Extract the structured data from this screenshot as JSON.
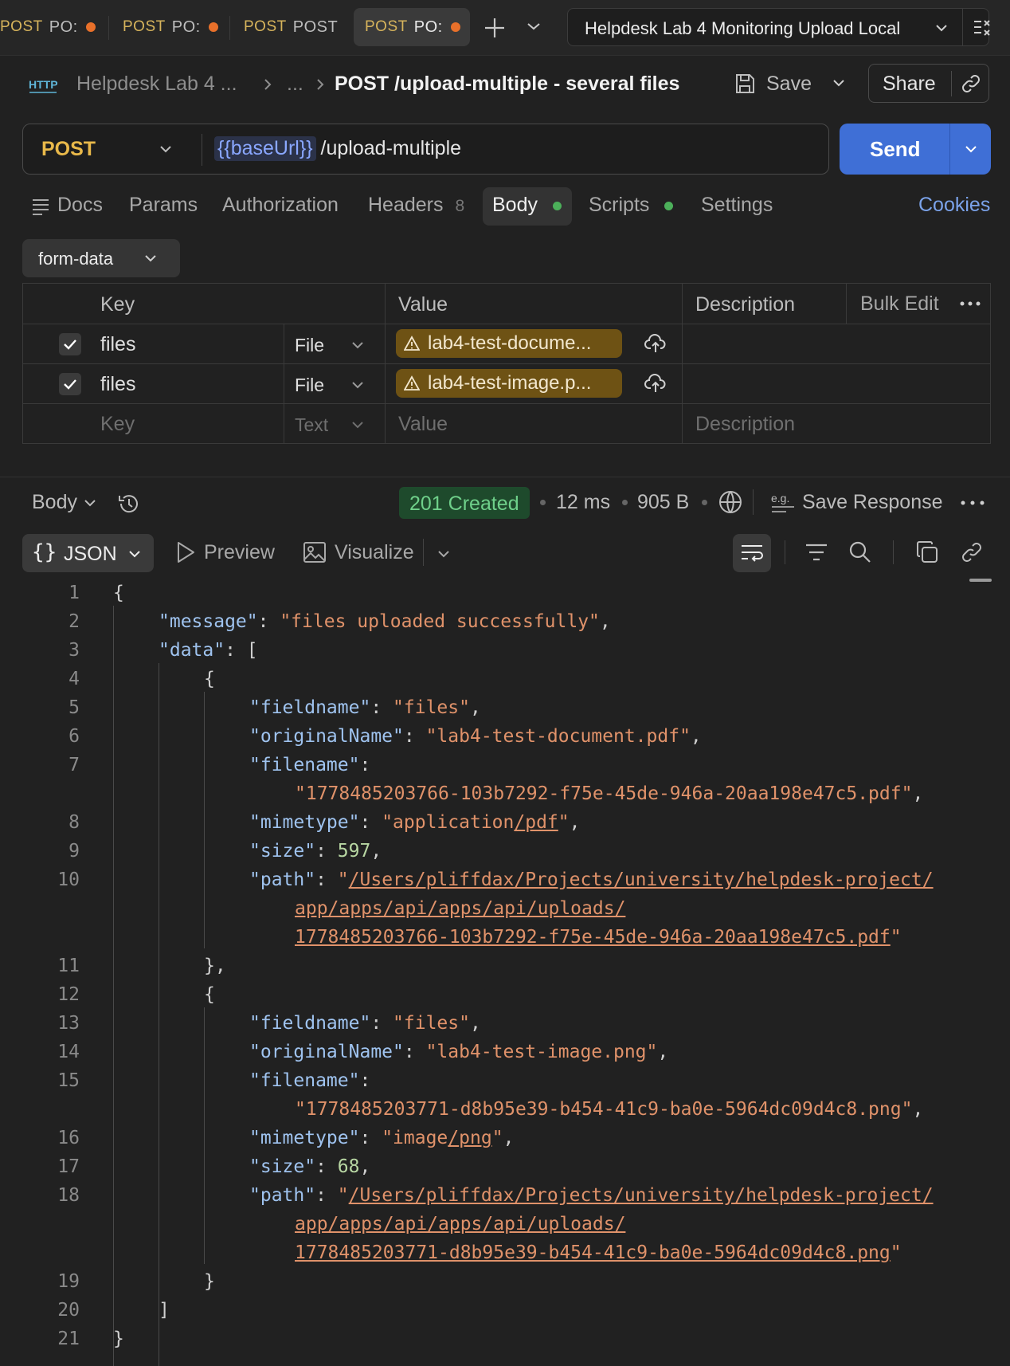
{
  "tabs": [
    {
      "method": "POST",
      "title": "PO:",
      "unsaved": true
    },
    {
      "method": "POST",
      "title": "PO:",
      "unsaved": true
    },
    {
      "method": "POST",
      "title": "POST",
      "unsaved": false
    },
    {
      "method": "POST",
      "title": "PO:",
      "unsaved": true,
      "active": true
    }
  ],
  "environment": "Helpdesk Lab 4 Monitoring Upload Local",
  "header": {
    "protocol_icon": "http-icon",
    "collection_crumb": "Helpdesk Lab 4 ...",
    "ellipsis_crumb": "...",
    "title": "POST /upload-multiple - several files",
    "save_label": "Save",
    "share_label": "Share"
  },
  "request": {
    "method": "POST",
    "url_variable": "{{baseUrl}}",
    "url_path": "/upload-multiple",
    "send_label": "Send"
  },
  "request_tabs": {
    "docs": "Docs",
    "params": "Params",
    "authorization": "Authorization",
    "headers": "Headers",
    "headers_count": "8",
    "body": "Body",
    "scripts": "Scripts",
    "settings": "Settings",
    "cookies": "Cookies"
  },
  "body_mode": "form-data",
  "form_table": {
    "headers": {
      "key": "Key",
      "value": "Value",
      "description": "Description",
      "bulk_edit": "Bulk Edit"
    },
    "rows": [
      {
        "checked": true,
        "key": "files",
        "type": "File",
        "value": "lab4-test-docume..."
      },
      {
        "checked": true,
        "key": "files",
        "type": "File",
        "value": "lab4-test-image.p..."
      }
    ],
    "placeholder": {
      "key": "Key",
      "type": "Text",
      "value": "Value",
      "description": "Description"
    }
  },
  "response": {
    "view_label": "Body",
    "status": "201 Created",
    "time": "12 ms",
    "size": "905 B",
    "save_response": "Save Response",
    "format": "JSON",
    "preview": "Preview",
    "visualize": "Visualize"
  },
  "code": {
    "line_numbers": [
      "1",
      "2",
      "3",
      "4",
      "5",
      "6",
      "7",
      "8",
      "9",
      "10",
      "11",
      "12",
      "13",
      "14",
      "15",
      "16",
      "17",
      "18",
      "19",
      "20",
      "21"
    ],
    "message_key": "\"message\"",
    "message_val": "\"files uploaded successfully\"",
    "data_key": "\"data\"",
    "files": [
      {
        "fieldname_key": "\"fieldname\"",
        "fieldname_val": "\"files\"",
        "original_key": "\"originalName\"",
        "original_val": "\"lab4-test-document.pdf\"",
        "filename_key": "\"filename\"",
        "filename_val": "\"1778485203766-103b7292-f75e-45de-946a-20aa198e47c5.pdf\"",
        "mimetype_key": "\"mimetype\"",
        "mimetype_a": "application",
        "mimetype_b": "pdf",
        "size_key": "\"size\"",
        "size_val": "597",
        "path_key": "\"path\"",
        "path_1": "/Users/pliffdax/Projects/university/helpdesk-project/",
        "path_2": "app/apps/api/apps/api/uploads/",
        "path_3": "1778485203766-103b7292-f75e-45de-946a-20aa198e47c5.pdf"
      },
      {
        "fieldname_key": "\"fieldname\"",
        "fieldname_val": "\"files\"",
        "original_key": "\"originalName\"",
        "original_val": "\"lab4-test-image.png\"",
        "filename_key": "\"filename\"",
        "filename_val": "\"1778485203771-d8b95e39-b454-41c9-ba0e-5964dc09d4c8.png\"",
        "mimetype_key": "\"mimetype\"",
        "mimetype_a": "image",
        "mimetype_b": "png",
        "size_key": "\"size\"",
        "size_val": "68",
        "path_key": "\"path\"",
        "path_1": "/Users/pliffdax/Projects/university/helpdesk-project/",
        "path_2": "app/apps/api/apps/api/uploads/",
        "path_3": "1778485203771-d8b95e39-b454-41c9-ba0e-5964dc09d4c8.png"
      }
    ]
  },
  "colors": {
    "accent": "#3f6fd6",
    "method": "#e9b94a",
    "status_ok": "#6fd08a",
    "unsaved_dot": "#e8702a",
    "json_key": "#9fc3ef",
    "json_string": "#e0926a",
    "json_number": "#b8d7a3"
  }
}
